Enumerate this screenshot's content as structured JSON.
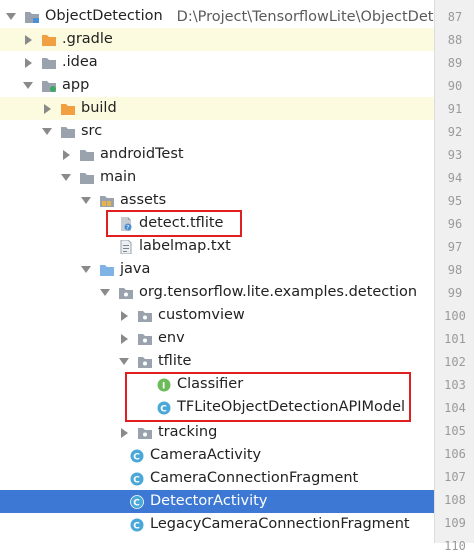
{
  "project": {
    "name": "ObjectDetection",
    "path": "D:\\Project\\TensorflowLite\\ObjectDetectio"
  },
  "tree": {
    "gradle": ".gradle",
    "idea": ".idea",
    "app": "app",
    "build": "build",
    "src": "src",
    "android_test": "androidTest",
    "main": "main",
    "assets": "assets",
    "detect_tflite": "detect.tflite",
    "labelmap": "labelmap.txt",
    "java": "java",
    "package": "org.tensorflow.lite.examples.detection",
    "customview": "customview",
    "env": "env",
    "tflite": "tflite",
    "classifier": "Classifier",
    "tflite_model": "TFLiteObjectDetectionAPIModel",
    "tracking": "tracking",
    "camera_activity": "CameraActivity",
    "camera_connection_fragment": "CameraConnectionFragment",
    "detector_activity": "DetectorActivity",
    "legacy_fragment": "LegacyCameraConnectionFragment"
  },
  "gutter": [
    "87",
    "88",
    "89",
    "90",
    "91",
    "92",
    "93",
    "94",
    "95",
    "96",
    "97",
    "98",
    "99",
    "100",
    "101",
    "102",
    "103",
    "104",
    "105",
    "106",
    "107",
    "108",
    "109",
    "110"
  ],
  "icons": {
    "folder_orange": "#f0a040",
    "folder_gray": "#9aa3ad",
    "folder_blue": "#7fb2e5",
    "class_c": "#4aa8d8",
    "interface_i": "#6cbb5a",
    "highlight_box": "#e02020"
  },
  "selected_item": "DetectorActivity"
}
